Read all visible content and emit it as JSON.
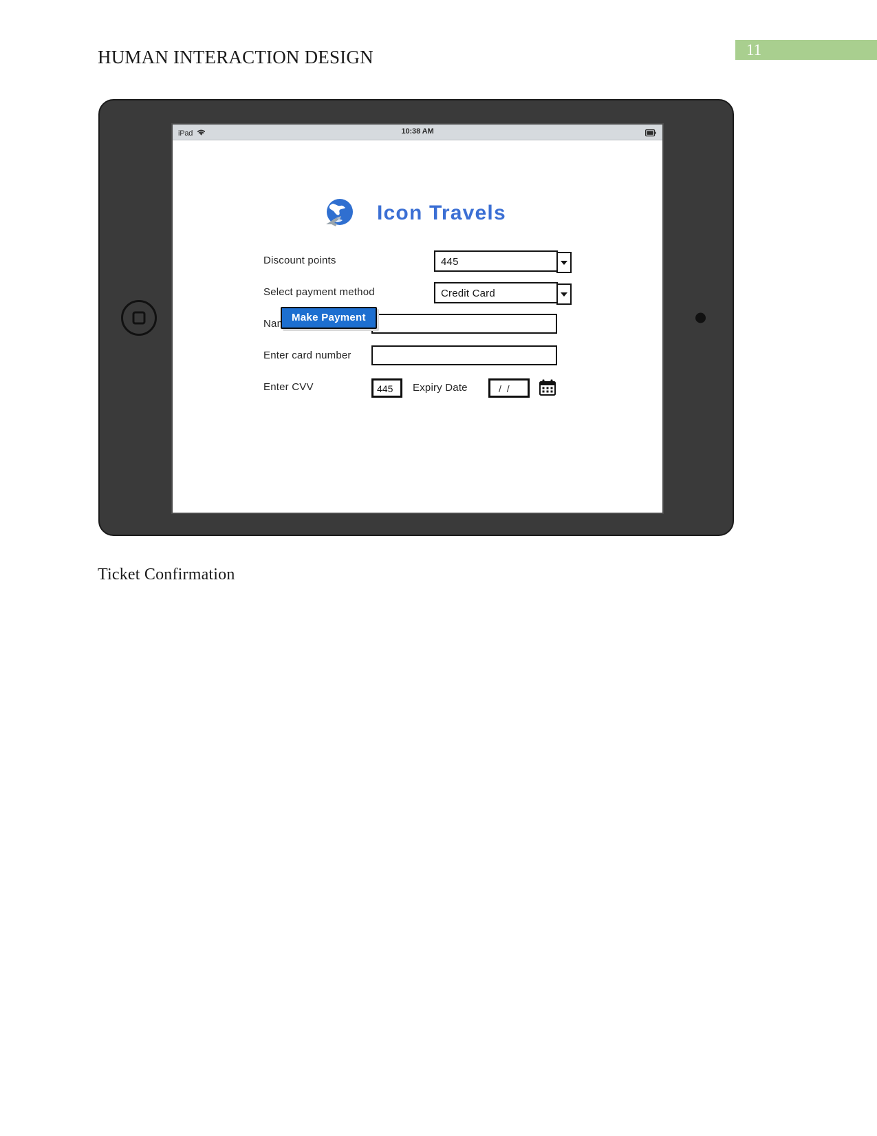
{
  "document": {
    "header_title": "HUMAN INTERACTION DESIGN",
    "page_number": "11",
    "page_number_bg": "#a9cf8f",
    "caption": "Ticket Confirmation"
  },
  "device": {
    "type": "ipad-mockup",
    "home_button": "home-button",
    "camera": "front-camera"
  },
  "status_bar": {
    "device_label": "iPad",
    "wifi_icon": "wifi-icon",
    "time": "10:38 AM",
    "battery_icon": "battery-icon"
  },
  "app": {
    "brand": {
      "logo_icon": "globe-plane-logo",
      "name": "Icon Travels",
      "brand_color": "#3b6fd4"
    },
    "form": {
      "rows": [
        {
          "label": "Discount points",
          "control": "select",
          "value": "445"
        },
        {
          "label": "Select payment method",
          "control": "select",
          "value": "Credit Card"
        },
        {
          "label": "Name on the card",
          "control": "text",
          "value": ""
        },
        {
          "label": "Enter card number",
          "control": "text",
          "value": ""
        }
      ],
      "cvv": {
        "label": "Enter CVV",
        "value": "445"
      },
      "expiry": {
        "label": "Expiry Date",
        "value": "/ /",
        "picker_icon": "calendar-icon"
      },
      "submit": {
        "label": "Make Payment",
        "color": "#1d6fd0"
      }
    }
  }
}
